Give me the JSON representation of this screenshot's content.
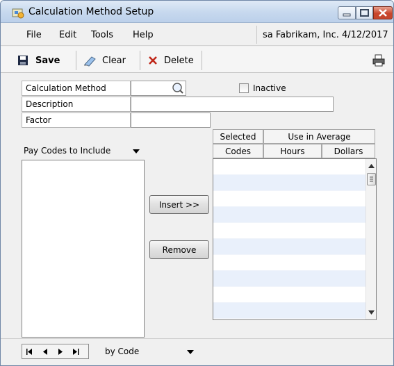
{
  "window": {
    "title": "Calculation Method Setup"
  },
  "menu": {
    "file": "File",
    "edit": "Edit",
    "tools": "Tools",
    "help": "Help",
    "status": "sa  Fabrikam, Inc.  4/12/2017"
  },
  "toolbar": {
    "save": "Save",
    "clear": "Clear",
    "delete": "Delete"
  },
  "form": {
    "calc_method_label": "Calculation Method",
    "calc_method_value": "",
    "inactive_label": "Inactive",
    "inactive_checked": false,
    "description_label": "Description",
    "description_value": "",
    "factor_label": "Factor",
    "factor_value": ""
  },
  "pay_codes": {
    "dropdown_label": "Pay Codes to Include",
    "items": []
  },
  "grid": {
    "selected_header": "Selected",
    "codes_header": "Codes",
    "use_avg_header": "Use in Average",
    "hours_header": "Hours",
    "dollars_header": "Dollars",
    "rows": []
  },
  "buttons": {
    "insert": "Insert >>",
    "remove": "Remove"
  },
  "footer": {
    "sort_value": "by Code"
  },
  "colors": {
    "row_alt": "#e9f0fb",
    "row": "#ffffff",
    "close_button": "#c4462c"
  }
}
